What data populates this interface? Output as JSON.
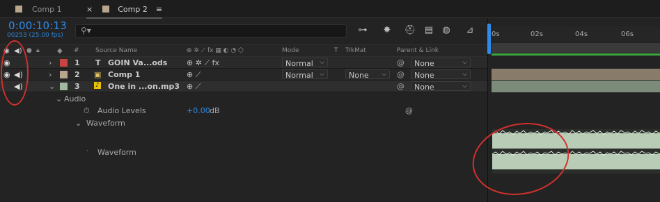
{
  "tabs": [
    {
      "label": "Comp 1",
      "close": "",
      "active": false
    },
    {
      "label": "Comp 2",
      "close": "×",
      "menu": "≡",
      "active": true
    }
  ],
  "timecode": "0:00:10:13",
  "fps": "00253 (25.00 fps)",
  "search": {
    "placeholder": ""
  },
  "columns": {
    "num": "#",
    "source_name": "Source Name",
    "mode": "Mode",
    "t": "T",
    "trkmat": "TrkMat",
    "parent": "Parent & Link"
  },
  "layers": [
    {
      "num": "1",
      "type_glyph": "T",
      "name": "GOIN Va...ods",
      "mode": "Normal",
      "trkmat": "",
      "parent": "None",
      "color": "#c84341"
    },
    {
      "num": "2",
      "type_glyph": "▣",
      "name": "Comp 1",
      "mode": "Normal",
      "trkmat": "None",
      "parent": "None",
      "color": "#b8a68c"
    },
    {
      "num": "3",
      "type_glyph": "♪",
      "name": "One in ...on.mp3",
      "mode": "",
      "trkmat": "",
      "parent": "None",
      "color": "#a3b8a0"
    }
  ],
  "audio_group": "Audio",
  "audio_levels": {
    "label": "Audio Levels",
    "value": "+0.00",
    "unit": "dB"
  },
  "waveform_group": "Waveform",
  "waveform_item": "Waveform",
  "ruler": [
    "0s",
    "02s",
    "04s",
    "06s"
  ],
  "colors": {
    "accent": "#2d8ceb",
    "annotation": "#d2312c",
    "work_area": "#3aa840",
    "comp_bar": "#8a7c6b",
    "audio_bar": "#a3b8a0"
  }
}
